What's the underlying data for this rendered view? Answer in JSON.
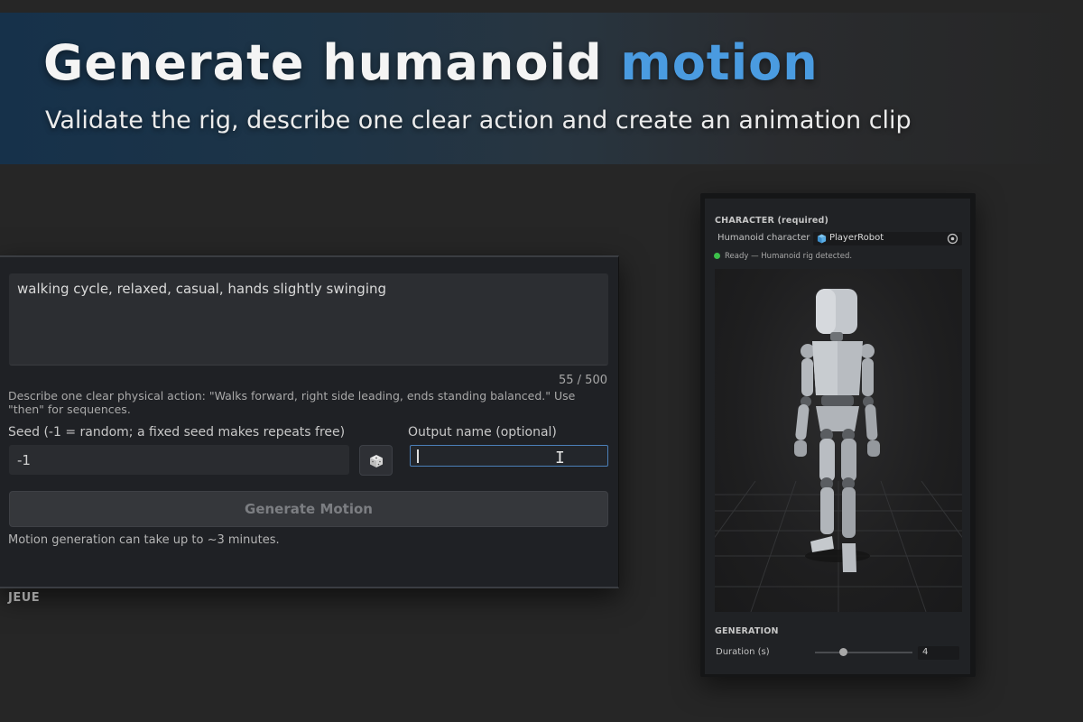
{
  "banner": {
    "title_main": "Generate humanoid ",
    "title_accent": "motion",
    "subtitle": "Validate the rig, describe one clear action and create an animation clip",
    "accent_color": "#4a9be0"
  },
  "form": {
    "prompt_value": "walking cycle, relaxed, casual, hands slightly swinging",
    "char_count": "55 / 500",
    "hint": "Describe one clear physical action: \"Walks forward, right side leading, ends standing balanced.\" Use \"then\" for sequences.",
    "seed_label": "Seed (-1 = random; a fixed seed makes repeats free)",
    "seed_value": "-1",
    "dice_icon": "dice-icon",
    "output_label": "Output name (optional)",
    "output_value": "",
    "generate_label": "Generate Motion",
    "generate_note": "Motion generation can take up to ~3 minutes.",
    "queue_label": "JEUE"
  },
  "inspector": {
    "character_section": "CHARACTER (required)",
    "character_field_label": "Humanoid character",
    "character_value": "PlayerRobot",
    "status_text": "Ready — Humanoid rig detected.",
    "status_color": "#3cc04a",
    "generation_section": "GENERATION",
    "duration_label": "Duration (s)",
    "duration_value": "4",
    "duration_slider_fraction": 0.27
  }
}
